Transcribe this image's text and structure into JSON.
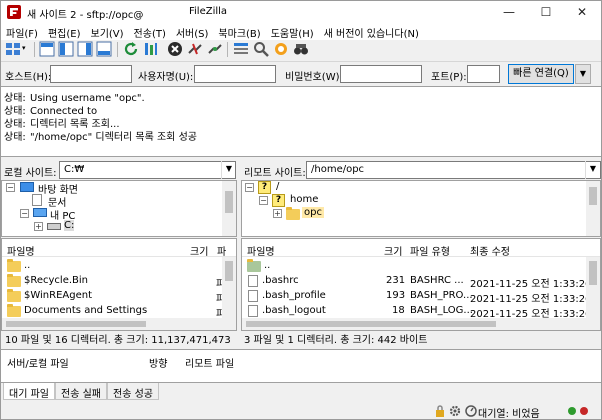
{
  "window": {
    "title": "새 사이트 2 - sftp://opc@",
    "app_name": "FileZilla",
    "minimize": "—",
    "maximize": "☐",
    "close": "✕"
  },
  "menu": [
    "파일(F)",
    "편집(E)",
    "보기(V)",
    "전송(T)",
    "서버(S)",
    "북마크(B)",
    "도움말(H)",
    "새 버전이 있습니다(N)"
  ],
  "quickconnect": {
    "host_label": "호스트(H):",
    "host_value": "",
    "user_label": "사용자명(U):",
    "user_value": "",
    "password_label": "비밀번호(W):",
    "password_value": "",
    "port_label": "포트(P):",
    "port_value": "",
    "connect_button": "빠른 연결(Q)",
    "dropdown_glyph": "▼"
  },
  "log": [
    {
      "key": "상태:",
      "msg": "Using username \"opc\"."
    },
    {
      "key": "상태:",
      "msg": "Connected to"
    },
    {
      "key": "상태:",
      "msg": "디렉터리 목록 조회..."
    },
    {
      "key": "상태:",
      "msg": "\"/home/opc\" 디렉터리 목록 조회 성공"
    }
  ],
  "local": {
    "site_label": "로컬 사이트:",
    "site_path": "C:₩",
    "tree": [
      "바탕 화면",
      "문서",
      "내 PC",
      "C:"
    ],
    "columns": {
      "name": "파일명",
      "size": "크기",
      "type": "파"
    },
    "files": [
      {
        "name": "..",
        "type": ""
      },
      {
        "name": "$Recycle.Bin",
        "type": "파"
      },
      {
        "name": "$WinREAgent",
        "type": "파"
      },
      {
        "name": "Documents and Settings",
        "type": "파"
      }
    ],
    "status": "10 파일 및 16 디렉터리. 총 크기: 11,137,471,473 바이트"
  },
  "remote": {
    "site_label": "리모트 사이트:",
    "site_path": "/home/opc",
    "tree": [
      "/",
      "home",
      "opc"
    ],
    "columns": {
      "name": "파일명",
      "size": "크기",
      "type": "파일 유형",
      "modified": "최종 수정"
    },
    "files": [
      {
        "name": "..",
        "size": "",
        "type": "",
        "modified": ""
      },
      {
        "name": ".bashrc",
        "size": "231",
        "type": "BASHRC ...",
        "modified": "2021-11-25 오전 1:33:26"
      },
      {
        "name": ".bash_profile",
        "size": "193",
        "type": "BASH_PRO...",
        "modified": "2021-11-25 오전 1:33:26"
      },
      {
        "name": ".bash_logout",
        "size": "18",
        "type": "BASH_LOG...",
        "modified": "2021-11-25 오전 1:33:26"
      }
    ],
    "status": "3 파일 및 1 디렉터리. 총 크기: 442 바이트"
  },
  "queue": {
    "col_file": "서버/로컬 파일",
    "col_direction": "방향",
    "col_remote": "리모트 파일"
  },
  "tabs": [
    "대기 파일",
    "전송 실패",
    "전송 성공"
  ],
  "statusbar": {
    "queue": "대기열: 비었음"
  },
  "colors": {
    "accent": "#0078d7",
    "folder": "#f4cd5a",
    "led_green": "#2e9b2e",
    "led_red": "#c62828"
  }
}
